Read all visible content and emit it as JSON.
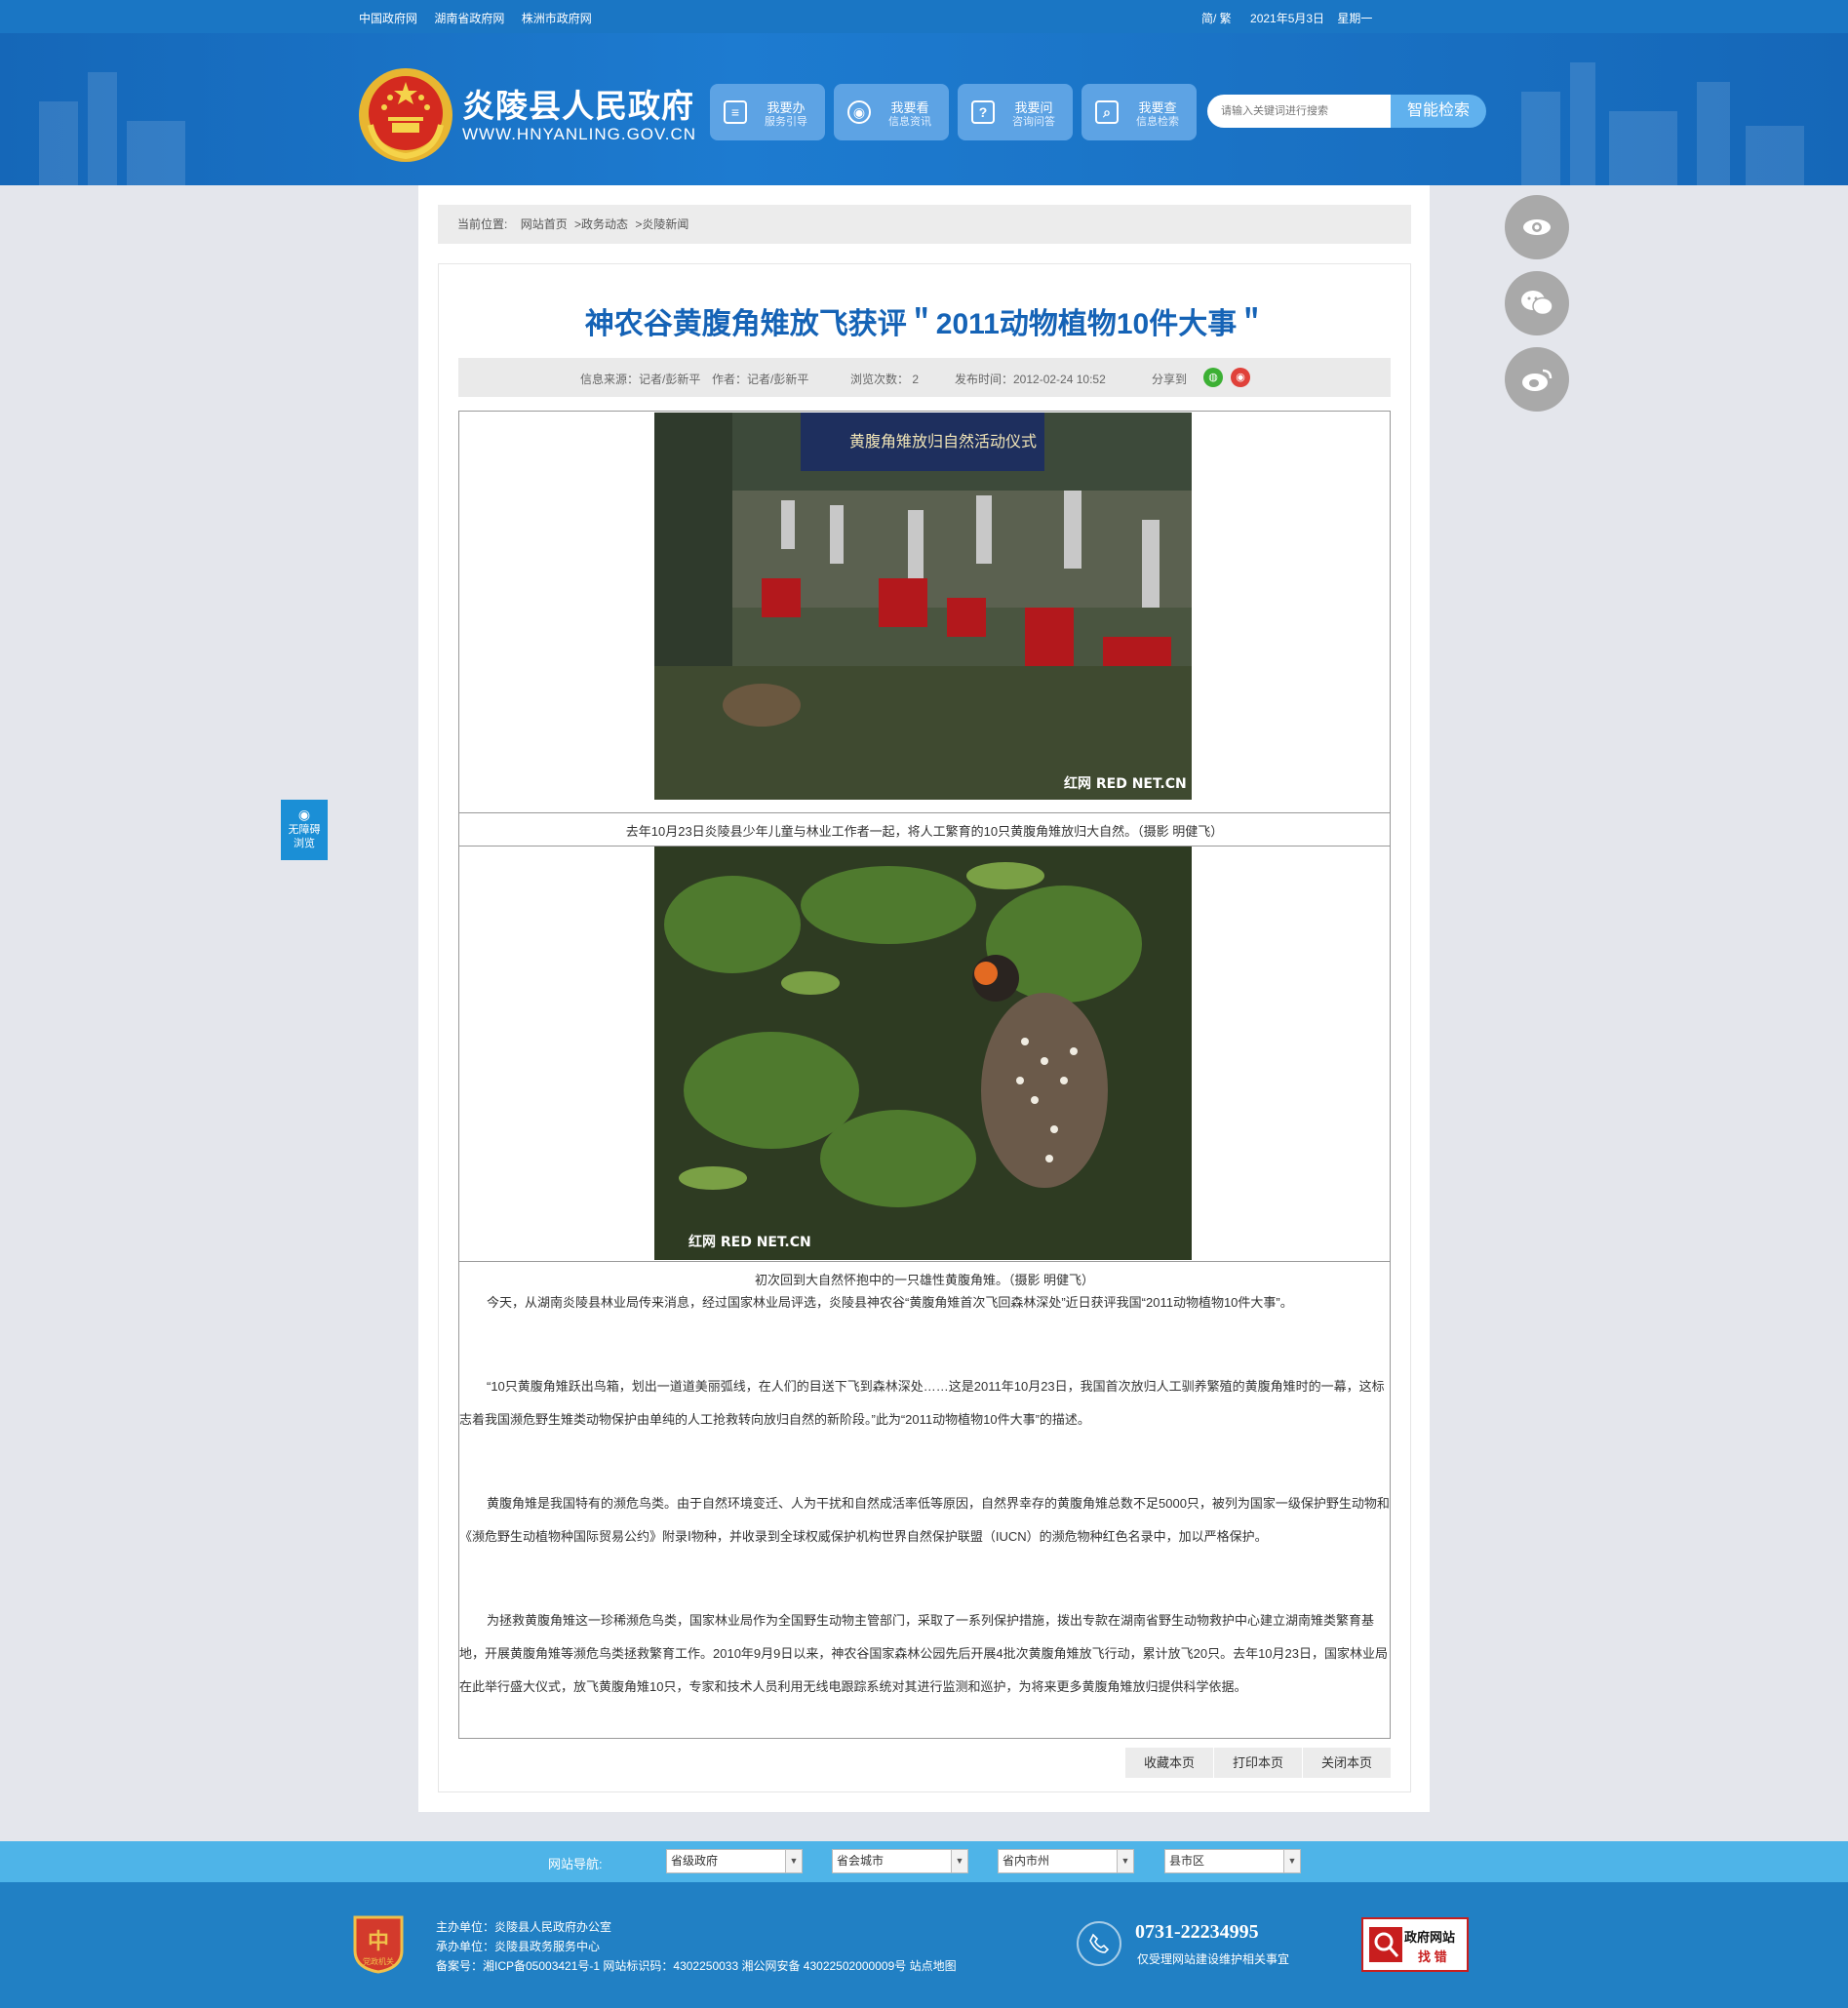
{
  "topbar": {
    "links": [
      "中国政府网",
      "湖南省政府网",
      "株洲市政府网"
    ],
    "lang_toggle": "简/ 繁",
    "date": "2021年5月3日",
    "weekday": "星期一"
  },
  "header": {
    "site_title": "炎陵县人民政府",
    "site_url": "WWW.HNYANLING.GOV.CN",
    "nav": [
      {
        "title": "我要办",
        "subtitle": "服务引导",
        "icon": "document-icon"
      },
      {
        "title": "我要看",
        "subtitle": "信息资讯",
        "icon": "eye-icon"
      },
      {
        "title": "我要问",
        "subtitle": "咨询问答",
        "icon": "question-icon"
      },
      {
        "title": "我要查",
        "subtitle": "信息检索",
        "icon": "search-icon"
      }
    ],
    "search_placeholder": "请输入关键词进行搜索",
    "search_button": "智能检索"
  },
  "breadcrumb": {
    "prefix": "当前位置:",
    "items": [
      "网站首页",
      ">政务动态",
      ">炎陵新闻"
    ]
  },
  "article": {
    "title": "神农谷黄腹角雉放飞获评＂2011动物植物10件大事＂",
    "meta": {
      "source": "信息来源：记者/彭新平",
      "author": "作者：记者/彭新平",
      "views": "浏览次数：  2",
      "published": "发布时间：2012-02-24 10:52",
      "share_label": "分享到"
    },
    "caption1": "去年10月23日炎陵县少年儿童与林业工作者一起，将人工繁育的10只黄腹角雉放归大自然。（摄影 明健飞）",
    "caption2": "初次回到大自然怀抱中的一只雄性黄腹角雉。（摄影 明健飞）",
    "paragraphs": [
      "今天，从湖南炎陵县林业局传来消息，经过国家林业局评选，炎陵县神农谷“黄腹角雉首次飞回森林深处”近日获评我国“2011动物植物10件大事”。",
      "“10只黄腹角雉跃出鸟箱，划出一道道美丽弧线，在人们的目送下飞到森林深处……这是2011年10月23日，我国首次放归人工驯养繁殖的黄腹角雉时的一幕，这标志着我国濒危野生雉类动物保护由单纯的人工抢救转向放归自然的新阶段。”此为“2011动物植物10件大事”的描述。",
      "黄腹角雉是我国特有的濒危鸟类。由于自然环境变迁、人为干扰和自然成活率低等原因，自然界幸存的黄腹角雉总数不足5000只，被列为国家一级保护野生动物和《濒危野生动植物种国际贸易公约》附录Ⅰ物种，并收录到全球权威保护机构世界自然保护联盟（IUCN）的濒危物种红色名录中，加以严格保护。",
      "为拯救黄腹角雉这一珍稀濒危鸟类，国家林业局作为全国野生动物主管部门，采取了一系列保护措施，拨出专款在湖南省野生动物救护中心建立湖南雉类繁育基地，开展黄腹角雉等濒危鸟类拯救繁育工作。2010年9月9日以来，神农谷国家森林公园先后开展4批次黄腹角雉放飞行动，累计放飞20只。去年10月23日，国家林业局在此举行盛大仪式，放飞黄腹角雉10只，专家和技术人员利用无线电跟踪系统对其进行监测和巡护，为将来更多黄腹角雉放归提供科学依据。"
    ],
    "watermark": "红网 RED NET.CN",
    "banner_text": "黄腹角雉放归自然活动仪式"
  },
  "actions": [
    "收藏本页",
    "打印本页",
    "关闭本页"
  ],
  "accessibility": "无障碍浏览",
  "footnav": {
    "label": "网站导航:",
    "selects": [
      "省级政府",
      "省会城市",
      "省内市州",
      "县市区"
    ]
  },
  "footer": {
    "host": "主办单位：炎陵县人民政府办公室",
    "organizer": "承办单位：炎陵县政务服务中心",
    "record": "备案号：湘ICP备05003421号-1 网站标识码：4302250033 湘公网安备 43022502000009号 站点地图",
    "phone": "0731-22234995",
    "phone_note": "仅受理网站建设维护相关事宜",
    "badge_line1": "政府网站",
    "badge_line2": "找 错",
    "party_badge": "党政机关"
  },
  "colors": {
    "brand_blue": "#1a76c4",
    "title_blue": "#1563b6",
    "footer_blue": "#2180c4",
    "footnav_blue": "#4eb4e8"
  }
}
